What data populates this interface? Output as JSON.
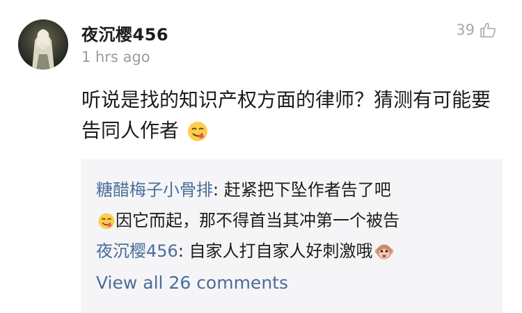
{
  "comment": {
    "username": "夜沉樱456",
    "timestamp": "1 hrs ago",
    "like_count": "39",
    "text": "听说是找的知识产权方面的律师？猜测有可能要告同人作者"
  },
  "replies": [
    {
      "author": "糖醋梅子小骨排",
      "separator": ": ",
      "text_before_emoji": "赶紧把下坠作者告了吧",
      "text_after_emoji": "因它而起，那不得首当其冲第一个被告"
    },
    {
      "author": "夜沉樱456",
      "separator": ": ",
      "text": "自家人打自家人好刺激哦"
    }
  ],
  "view_all_label": "View all 26 comments",
  "colors": {
    "link_blue": "#4a6d9a",
    "muted_gray": "#9b9b9b",
    "reply_background": "#f5f5f7"
  },
  "icons": {
    "like": "thumbs-up-icon",
    "emoji_comment": "yum-face-emoji",
    "emoji_reply_1": "yum-face-emoji",
    "emoji_reply_2": "monkey-face-emoji"
  }
}
